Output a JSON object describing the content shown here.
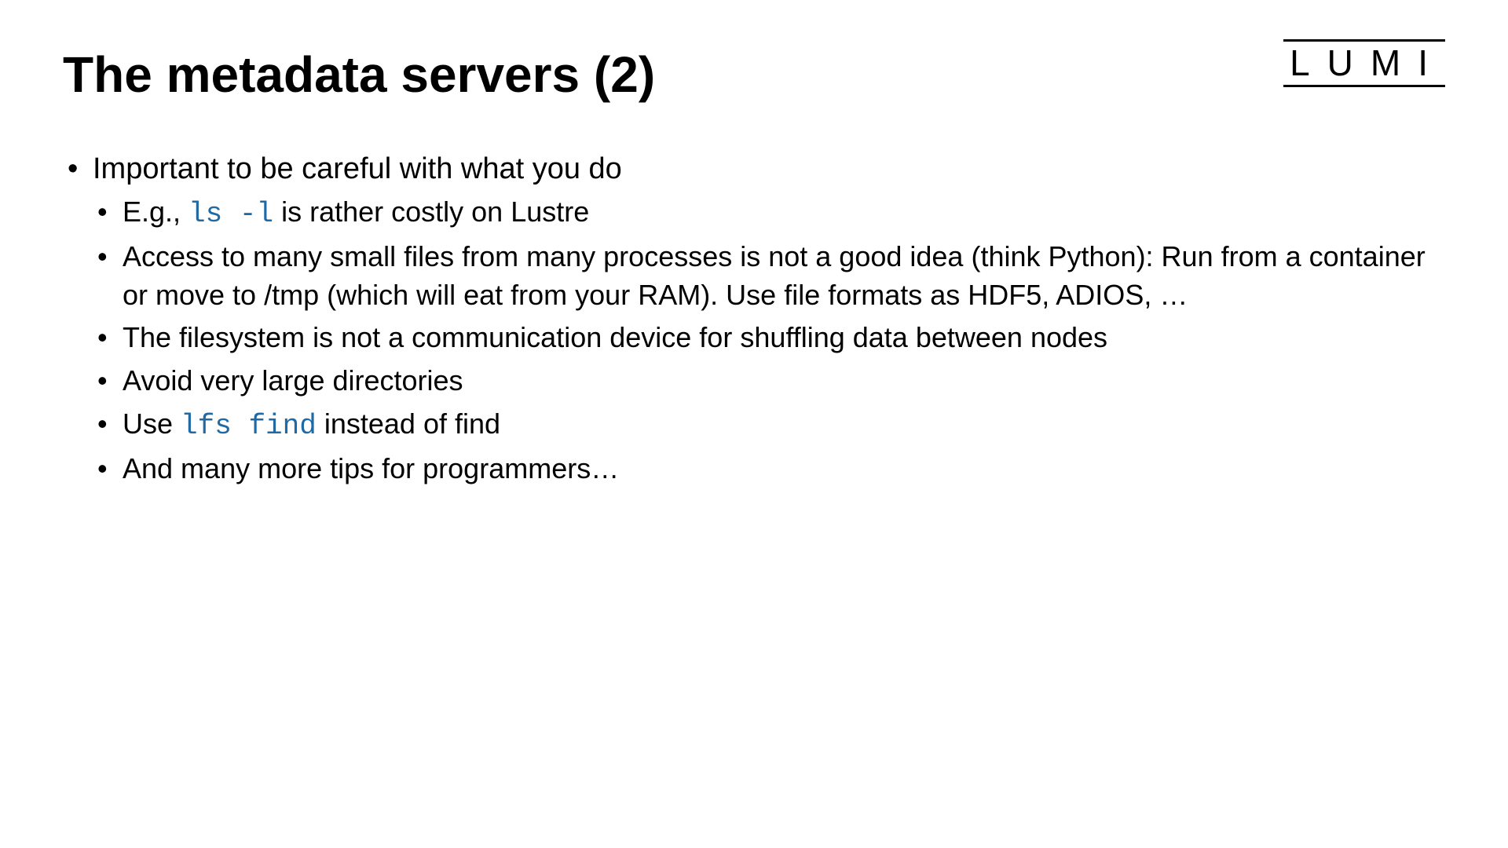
{
  "logo": "LUMI",
  "title": "The metadata servers (2)",
  "bullets": {
    "main": "Important to be careful with what you do",
    "sub1_pre": "E.g., ",
    "sub1_code": "ls -l",
    "sub1_post": " is rather costly on Lustre",
    "sub2": "Access to many small files from many processes is not a good idea (think Python): Run from a container or move to /tmp (which will eat from your RAM). Use file formats as HDF5, ADIOS, …",
    "sub3": "The filesystem is not a communication device for shuffling data between nodes",
    "sub4": "Avoid very large directories",
    "sub5_pre": "Use ",
    "sub5_code": "lfs find",
    "sub5_post": " instead of find",
    "sub6": "And many more tips for programmers…"
  }
}
